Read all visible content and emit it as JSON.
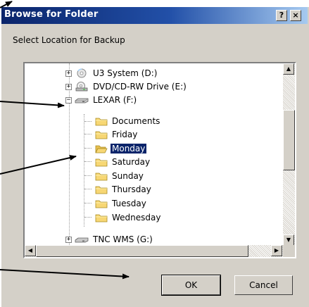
{
  "window": {
    "title": "Browse for Folder",
    "help_label": "?",
    "close_label": "×"
  },
  "prompt": "Select Location for Backup",
  "tree": {
    "items": [
      {
        "label": "U3 System (D:)",
        "icon": "cd-drive-icon",
        "expander": "+"
      },
      {
        "label": "DVD/CD-RW Drive (E:)",
        "icon": "dvd-drive-icon",
        "expander": "+"
      },
      {
        "label": "LEXAR (F:)",
        "icon": "removable-drive-icon",
        "expander": "−"
      },
      {
        "label": "Documents",
        "icon": "folder-icon"
      },
      {
        "label": "Friday",
        "icon": "folder-icon"
      },
      {
        "label": "Monday",
        "icon": "folder-icon",
        "selected": true
      },
      {
        "label": "Saturday",
        "icon": "folder-icon"
      },
      {
        "label": "Sunday",
        "icon": "folder-icon"
      },
      {
        "label": "Thursday",
        "icon": "folder-icon"
      },
      {
        "label": "Tuesday",
        "icon": "folder-icon"
      },
      {
        "label": "Wednesday",
        "icon": "folder-icon"
      },
      {
        "label": "TNC WMS (G:)",
        "icon": "network-drive-icon",
        "expander": "+"
      }
    ]
  },
  "buttons": {
    "ok": "OK",
    "cancel": "Cancel"
  },
  "scroll_glyphs": {
    "up": "▲",
    "down": "▼",
    "left": "◀",
    "right": "▶"
  },
  "colors": {
    "titlebar_start": "#0a246a",
    "titlebar_end": "#a6caf0",
    "dialog_face": "#d4d0c8",
    "selection": "#0a246a"
  }
}
